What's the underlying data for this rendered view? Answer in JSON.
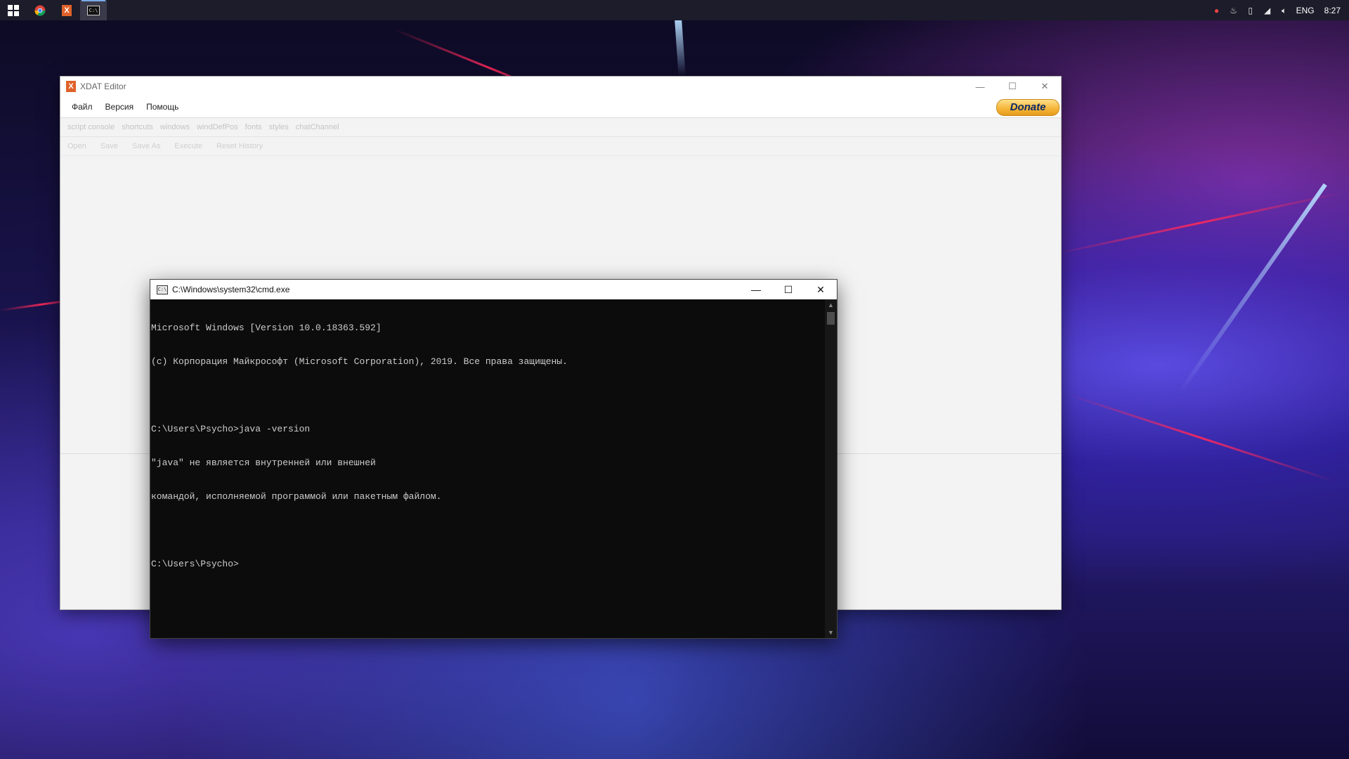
{
  "taskbar": {
    "pinned": [
      {
        "name": "windows-start-icon",
        "glyph": "⊞"
      },
      {
        "name": "chrome-icon",
        "glyph": "◉"
      },
      {
        "name": "xdat-editor-icon",
        "glyph": "X"
      },
      {
        "name": "cmd-icon",
        "glyph": "C:\\"
      }
    ],
    "tray": {
      "language": "ENG",
      "time": "8:27"
    }
  },
  "xdat": {
    "title": "XDAT Editor",
    "menu": [
      "Файл",
      "Версия",
      "Помощь"
    ],
    "donate_label": "Donate",
    "tabs": [
      "script console",
      "shortcuts",
      "windows",
      "windDefPos",
      "fonts",
      "styles",
      "chatChannel"
    ],
    "tools": [
      "Open",
      "Save",
      "Save As",
      "Execute",
      "Reset History"
    ]
  },
  "cmd": {
    "title": "C:\\Windows\\system32\\cmd.exe",
    "lines": [
      "Microsoft Windows [Version 10.0.18363.592]",
      "(c) Корпорация Майкрософт (Microsoft Corporation), 2019. Все права защищены.",
      "",
      "C:\\Users\\Psycho>java -version",
      "\"java\" не является внутренней или внешней",
      "командой, исполняемой программой или пакетным файлом.",
      "",
      "C:\\Users\\Psycho>"
    ]
  },
  "colors": {
    "taskbar": "#1c1c2a",
    "donate_text": "#0b2a66",
    "cmd_bg": "#0c0c0c",
    "cmd_text": "#cccccc"
  }
}
